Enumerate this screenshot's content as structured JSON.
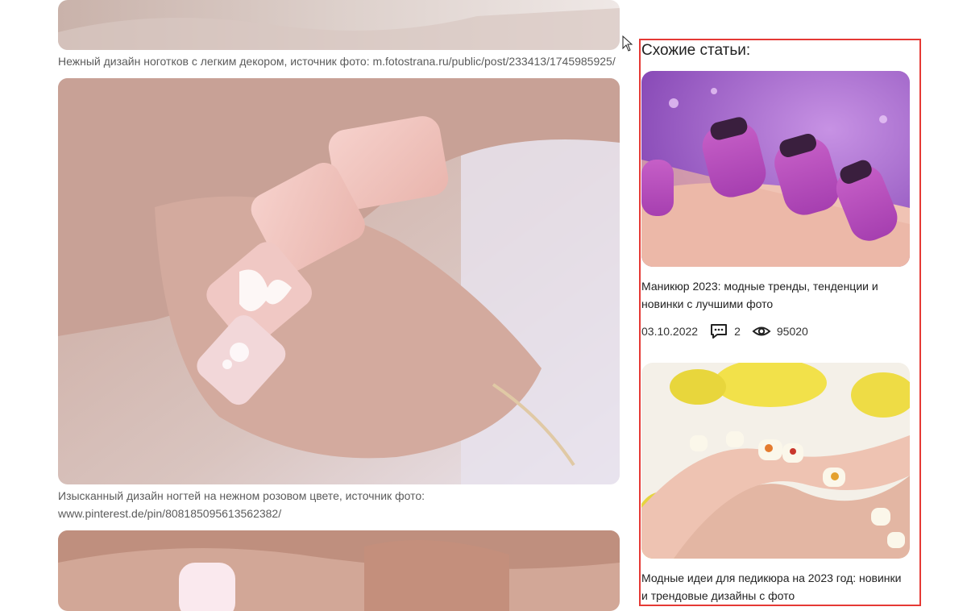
{
  "main": {
    "captions": [
      "Нежный дизайн ноготков с легким декором, источник фото: m.fotostrana.ru/public/post/233413/1745985925/",
      "Изысканный дизайн ногтей на нежном розовом цвете, источник фото:",
      "www.pinterest.de/pin/808185095613562382/"
    ]
  },
  "sidebar": {
    "title": "Схожие статьи:",
    "articles": [
      {
        "title": "Маникюр 2023: модные тренды, тенденции и новинки с лучшими фото",
        "date": "03.10.2022",
        "comments": "2",
        "views": "95020",
        "comment_icon": "comment-icon",
        "views_icon": "eye-icon"
      },
      {
        "title": "Модные идеи для педикюра на 2023 год: новинки и трендовые дизайны с фото"
      }
    ]
  },
  "colors": {
    "highlight_border": "#e53935",
    "caption": "#5b5b5b"
  }
}
